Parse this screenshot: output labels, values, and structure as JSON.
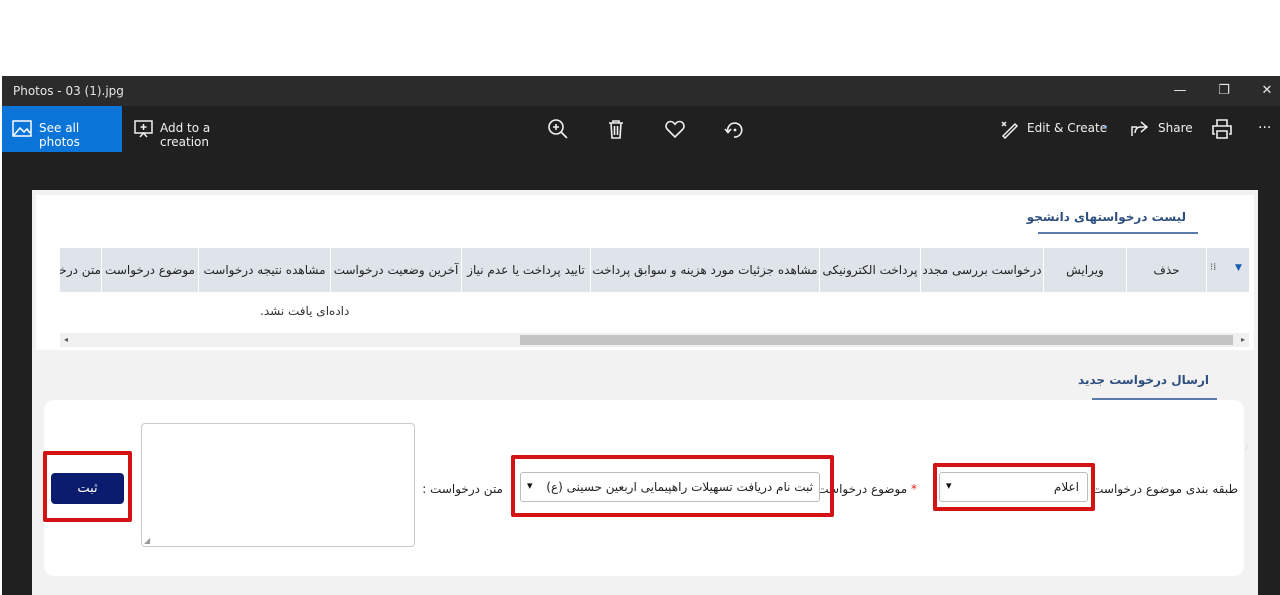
{
  "window": {
    "title": "Photos - 03 (1).jpg",
    "minimize": "—",
    "maximize": "❐",
    "close": "✕"
  },
  "toolbar": {
    "see_all": "See all photos",
    "add_creation": "Add to a creation",
    "edit_create": "Edit & Create",
    "share": "Share",
    "more": "···"
  },
  "page": {
    "list_title": "لیست درخواستهای دانشجو",
    "grid": {
      "columns": [
        "حذف",
        "ویرایش",
        "درخواست بررسی مجدد",
        "پرداخت الکترونیکی",
        "مشاهده جزئیات مورد هزینه و سوابق پرداخت",
        "تایید پرداخت یا عدم نیاز",
        "آخرین وضعیت درخواست",
        "مشاهده نتیجه درخواست",
        "موضوع درخواست",
        "متن درخواست"
      ],
      "empty_message": "داده‌ای یافت نشد."
    },
    "new_request_title": "ارسال درخواست جدید",
    "form": {
      "category_label": "طبقه بندی موضوع درخواست",
      "category_value": "اعلام",
      "subject_label": "موضوع درخواست",
      "required_mark": "*",
      "subject_value": "ثبت نام دریافت تسهیلات راهپیمایی اربعین حسینی (ع)",
      "text_label": "متن درخواست :",
      "submit": "ثبت"
    }
  },
  "colors": {
    "accent": "#0a74d8",
    "submit_button": "#0b1c6e",
    "highlight_box": "#d41414",
    "section_title": "#2f4f7f"
  }
}
